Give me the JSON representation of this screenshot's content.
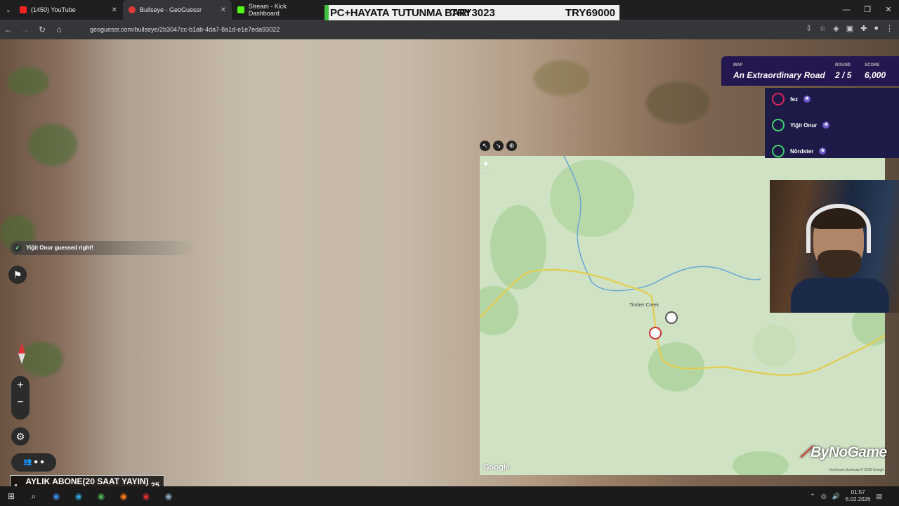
{
  "browser": {
    "tabs": [
      {
        "label": "(1450) YouTube",
        "fav": "#ff2020"
      },
      {
        "label": "Bullseye - GeoGuessr",
        "fav": "#e03b3b"
      },
      {
        "label": "Stream - Kick Dashboard",
        "fav": "#53fc18"
      }
    ],
    "url": "geoguessr.com/bullseye/2b3047cc-b1ab-4da7-8a1d-e1e7eda93022"
  },
  "banner": {
    "text1": "PC+HAYATA TUTUNMA BARI",
    "text2": "TRY3023",
    "text3": "TRY69000"
  },
  "hud": {
    "map_label": "MAP",
    "map_name": "An Extraordinary Road",
    "round_label": "ROUND",
    "round": "2 / 5",
    "score_label": "SCORE",
    "score": "6,000"
  },
  "players": [
    {
      "name": "fez",
      "color": "#e0245e"
    },
    {
      "name": "Yiğit Onur",
      "color": "#3fd16c"
    },
    {
      "name": "Nördster",
      "color": "#3fd16c"
    }
  ],
  "notification": "Yiğit Onur guessed right!",
  "map": {
    "place": "Timber Creek",
    "logo": "Google",
    "footer": "Keyboard shortcuts  © 2026 Google  Terms"
  },
  "subs": {
    "left": "1",
    "text": "AYLIK ABONE(20 SAAT YAYIN)",
    "right": "25"
  },
  "brand": {
    "text": "ByNoGame"
  },
  "taskbar": {
    "time": "01:57",
    "date": "6.02.2026"
  }
}
